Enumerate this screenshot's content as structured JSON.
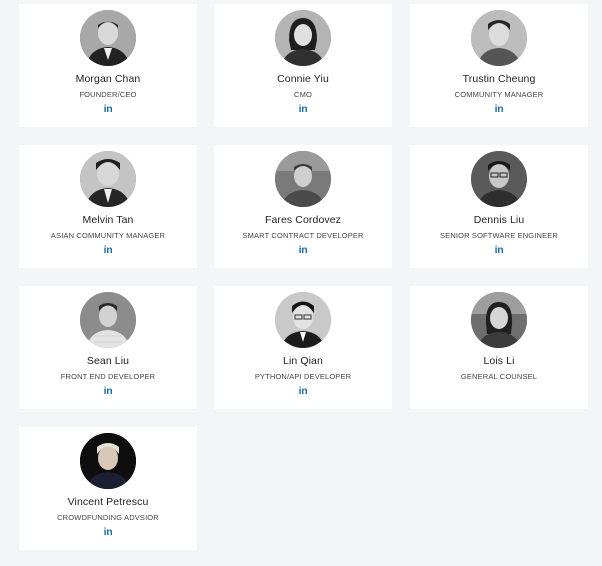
{
  "team": {
    "members": [
      {
        "name": "Morgan Chan",
        "title": "FOUNDER/CEO",
        "social_icon": "linkedin-icon",
        "social_label": "in",
        "photo": "grayscale-portrait-man-suit"
      },
      {
        "name": "Connie Yiu",
        "title": "CMO",
        "social_icon": "linkedin-icon",
        "social_label": "in",
        "photo": "grayscale-portrait-woman"
      },
      {
        "name": "Trustin Cheung",
        "title": "COMMUNITY MANAGER",
        "social_icon": "linkedin-icon",
        "social_label": "in",
        "photo": "grayscale-portrait-man"
      },
      {
        "name": "Melvin Tan",
        "title": "ASIAN COMMUNITY MANAGER",
        "social_icon": "linkedin-icon",
        "social_label": "in",
        "photo": "grayscale-portrait-man-suit"
      },
      {
        "name": "Fares Cordovez",
        "title": "SMART CONTRACT DEVELOPER",
        "social_icon": "linkedin-icon",
        "social_label": "in",
        "photo": "grayscale-portrait-man-outdoor"
      },
      {
        "name": "Dennis Liu",
        "title": "SENIOR SOFTWARE ENGINEER",
        "social_icon": "linkedin-icon",
        "social_label": "in",
        "photo": "grayscale-portrait-man-glasses"
      },
      {
        "name": "Sean Liu",
        "title": "FRONT END DEVELOPER",
        "social_icon": "linkedin-icon",
        "social_label": "in",
        "photo": "grayscale-portrait-man-shirt"
      },
      {
        "name": "Lin Qian",
        "title": "PYTHON/API DEVELOPER",
        "social_icon": "linkedin-icon",
        "social_label": "in",
        "photo": "grayscale-portrait-man-glasses"
      },
      {
        "name": "Lois Li",
        "title": "GENERAL COUNSEL",
        "social_icon": "",
        "social_label": "",
        "photo": "grayscale-portrait-woman-outdoor"
      },
      {
        "name": "Vincent Petrescu",
        "title": "CROWDFUNDING ADVSIOR",
        "social_icon": "linkedin-icon",
        "social_label": "in",
        "photo": "portrait-man-dark-background"
      }
    ]
  },
  "colors": {
    "page_background": "#f4f5f7",
    "card_background": "#ffffff",
    "name_text": "#222222",
    "title_text": "#444444",
    "linkedin_blue": "#1e6ea7"
  }
}
